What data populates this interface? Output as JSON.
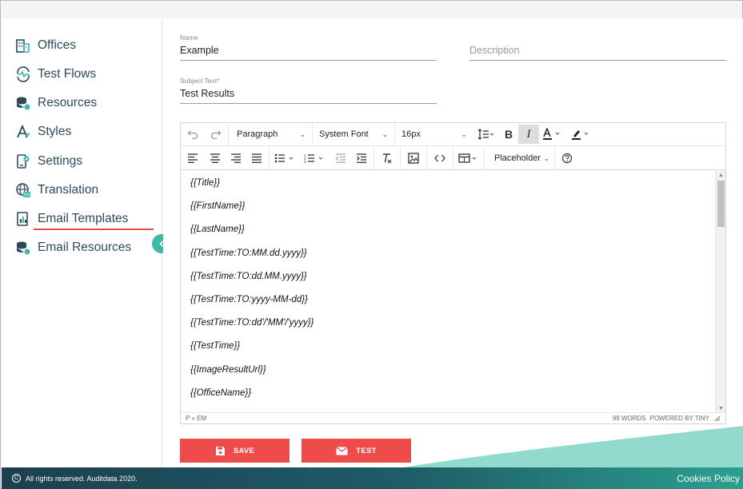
{
  "sidebar": {
    "items": [
      {
        "label": "Offices",
        "icon": "offices-icon"
      },
      {
        "label": "Test Flows",
        "icon": "test-flows-icon"
      },
      {
        "label": "Resources",
        "icon": "resources-icon"
      },
      {
        "label": "Styles",
        "icon": "styles-icon"
      },
      {
        "label": "Settings",
        "icon": "settings-icon"
      },
      {
        "label": "Translation",
        "icon": "translation-icon"
      },
      {
        "label": "Email Templates",
        "icon": "email-templates-icon"
      },
      {
        "label": "Email Resources",
        "icon": "email-resources-icon"
      }
    ],
    "active": "Email Templates"
  },
  "form": {
    "name_label": "Name",
    "name_value": "Example",
    "description_placeholder": "Description",
    "subject_label": "Subject Text*",
    "subject_value": "Test Results"
  },
  "editor": {
    "block_format": "Paragraph",
    "font_family": "System Font",
    "font_size": "16px",
    "placeholder_menu": "Placeholder",
    "content": [
      "{{Title}}",
      "{{FirstName}}",
      "{{LastName}}",
      "{{TestTime:TO:MM.dd.yyyy}}",
      "{{TestTime:TO:dd.MM.yyyy}}",
      "{{TestTime:TO:yyyy-MM-dd}}",
      "{{TestTime:TO:dd'/'MM'/'yyyy}}",
      "{{TestTime}}",
      "{{ImageResultUrl}}",
      "{{OfficeName}}"
    ],
    "path": "P » EM",
    "word_count": "99 WORDS",
    "powered_by": "POWERED BY TINY"
  },
  "actions": {
    "save_label": "SAVE",
    "test_label": "TEST"
  },
  "footer": {
    "copyright": "All rights reserved. Auditdata 2020.",
    "cookies": "Cookies Policy"
  },
  "colors": {
    "accent_red": "#ee4b4b",
    "teal": "#3cbaa6",
    "nav_text": "#2c4a5a"
  }
}
